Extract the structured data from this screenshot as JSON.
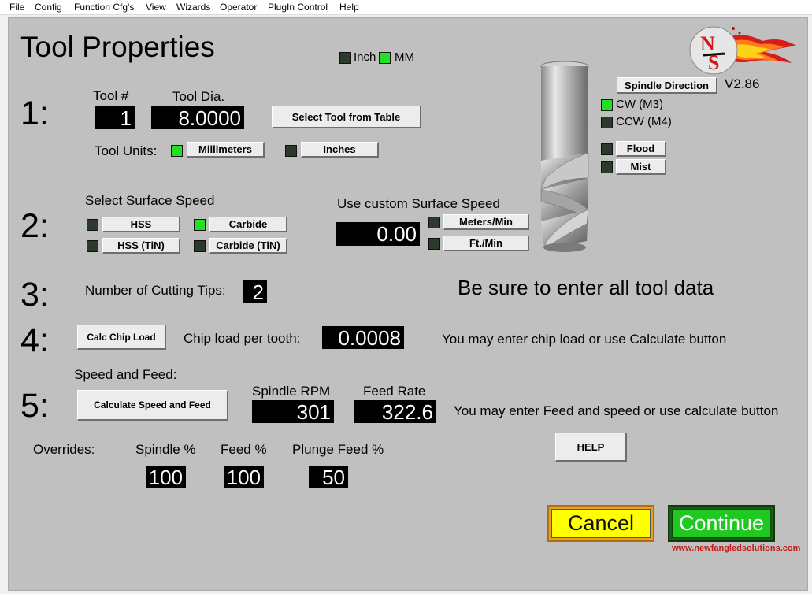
{
  "menu": [
    "File",
    "Config",
    "Function Cfg's",
    "View",
    "Wizards",
    "Operator",
    "PlugIn Control",
    "Help"
  ],
  "title": "Tool Properties",
  "units_indicator": {
    "inch": "Inch",
    "mm": "MM",
    "inch_on": false,
    "mm_on": true
  },
  "version": "V2.86",
  "steps": [
    "1:",
    "2:",
    "3:",
    "4:",
    "5:"
  ],
  "tool": {
    "number_label": "Tool #",
    "number": "1",
    "dia_label": "Tool Dia.",
    "dia": "8.0000",
    "select_button": "Select Tool from Table",
    "units_label": "Tool Units:",
    "mm_button": "Millimeters",
    "inch_button": "Inches",
    "mm_on": true,
    "inch_on": false
  },
  "spindle": {
    "direction_button": "Spindle Direction",
    "cw": "CW (M3)",
    "ccw": "CCW (M4)",
    "cw_on": true,
    "ccw_on": false,
    "flood": "Flood",
    "mist": "Mist"
  },
  "surface": {
    "label": "Select Surface Speed",
    "hss": "HSS",
    "carbide": "Carbide",
    "hss_tin": "HSS (TiN)",
    "carbide_tin": "Carbide (TiN)",
    "carbide_on": true,
    "custom_label": "Use custom Surface Speed",
    "custom_value": "0.00",
    "meters_button": "Meters/Min",
    "feet_button": "Ft./Min"
  },
  "tips": {
    "label": "Number of Cutting Tips:",
    "value": "2"
  },
  "notice": "Be sure to enter all tool data",
  "chip": {
    "button": "Calc Chip Load",
    "label": "Chip load per tooth:",
    "value": "0.0008",
    "hint": "You may enter chip load or use Calculate button"
  },
  "speedfeed": {
    "label": "Speed and Feed:",
    "button": "Calculate Speed and Feed",
    "rpm_label": "Spindle RPM",
    "rpm": "301",
    "feed_label": "Feed Rate",
    "feed": "322.6",
    "hint": "You may enter Feed and speed or use calculate button"
  },
  "overrides": {
    "label": "Overrides:",
    "spindle_label": "Spindle %",
    "spindle": "100",
    "feed_label": "Feed %",
    "feed": "100",
    "plunge_label": "Plunge Feed %",
    "plunge": "50"
  },
  "help_button": "HELP",
  "cancel_button": "Cancel",
  "continue_button": "Continue",
  "website": "www.newfangledsolutions.com",
  "colors": {
    "panel": "#c0c0c0",
    "led_on": "#22e022",
    "led_off": "#2b3a2b",
    "cancel": "#ffff00",
    "continue": "#1fc91f"
  }
}
